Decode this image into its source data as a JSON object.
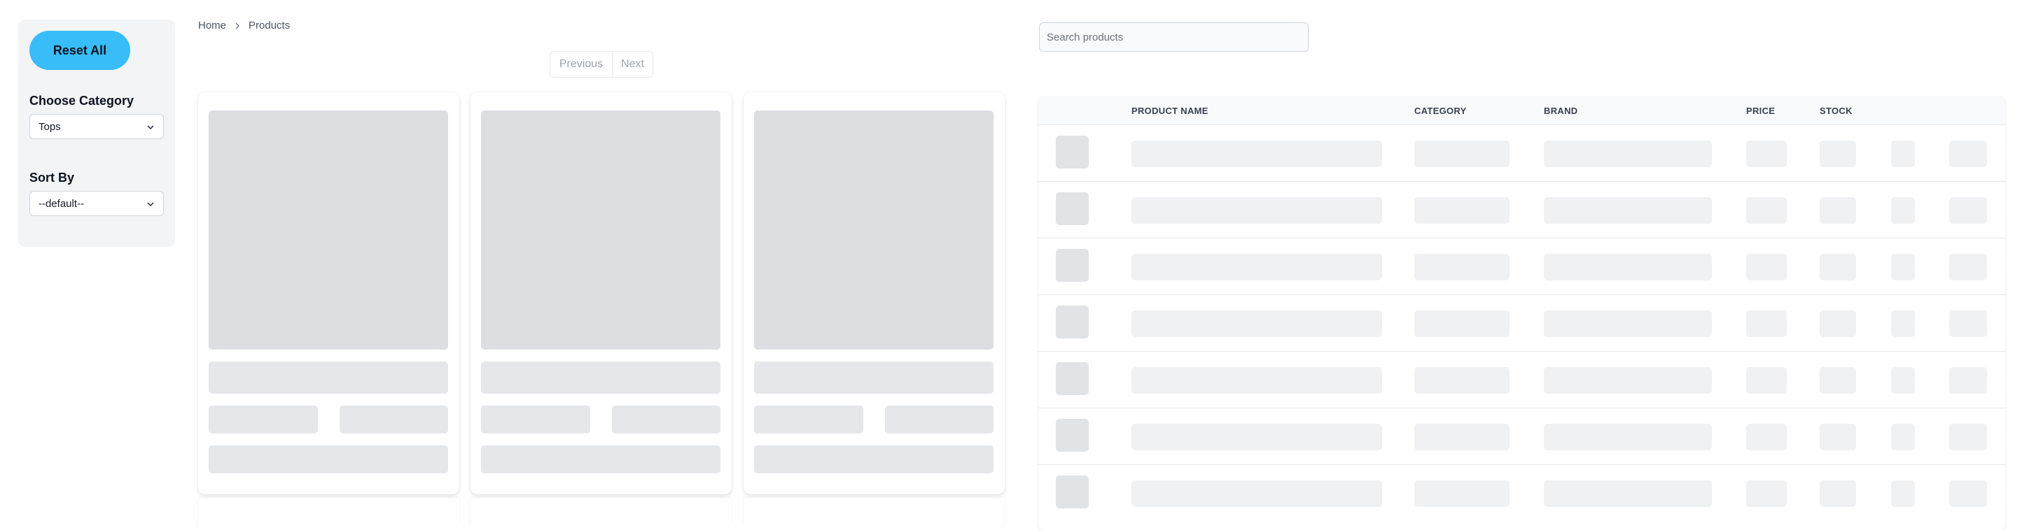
{
  "sidebar": {
    "reset_label": "Reset All",
    "category_label": "Choose Category",
    "category_value": "Tops",
    "sort_label": "Sort By",
    "sort_value": "--default--"
  },
  "breadcrumb": {
    "home": "Home",
    "current": "Products"
  },
  "pager": {
    "previous": "Previous",
    "next": "Next"
  },
  "search": {
    "placeholder": "Search products"
  },
  "table": {
    "columns": [
      "PRODUCT NAME",
      "CATEGORY",
      "BRAND",
      "PRICE",
      "STOCK"
    ]
  },
  "colors": {
    "accent": "#38bdf8",
    "skeleton": "#e5e7eb"
  },
  "icons": {
    "breadcrumb_separator": "chevron-right-icon",
    "select_arrow": "chevron-down-icon"
  }
}
